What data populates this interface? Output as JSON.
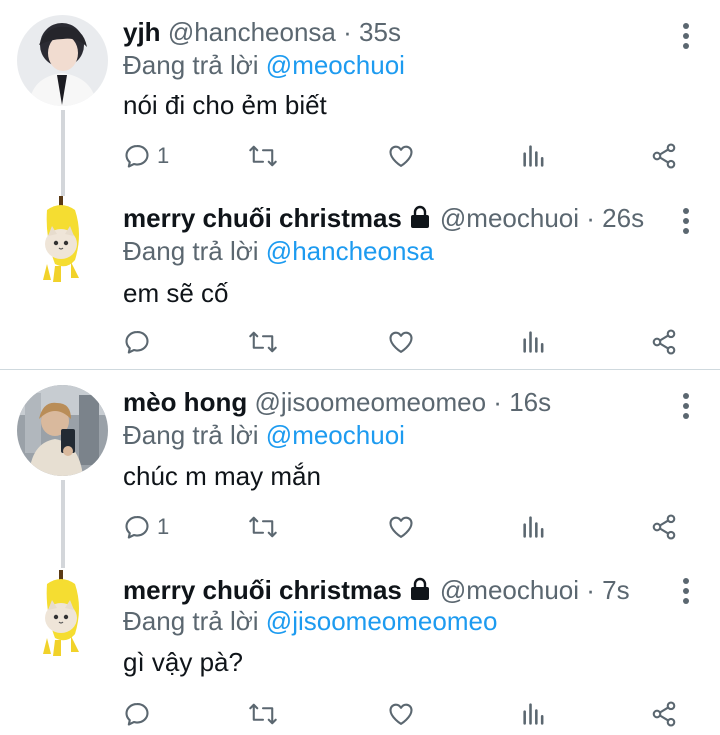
{
  "replying_prefix": "Đang trả lời",
  "conversations": [
    {
      "parent": {
        "name": "yjh",
        "handle": "@hancheonsa",
        "separator": "·",
        "time": "35s",
        "replying_to": "@meochuoi",
        "text": "nói đi cho ẻm biết",
        "reply_count": "1"
      },
      "reply": {
        "name": "merry chuối christmas",
        "handle": "@meochuoi",
        "separator": "·",
        "time": "26s",
        "replying_to": "@hancheonsa",
        "text": "em sẽ cố",
        "reply_count": ""
      }
    },
    {
      "parent": {
        "name": "mèo hong",
        "handle": "@jisoomeomeomeo",
        "separator": "·",
        "time": "16s",
        "replying_to": "@meochuoi",
        "text": "chúc m may mắn",
        "reply_count": "1"
      },
      "reply": {
        "name": "merry chuối christmas",
        "handle": "@meochuoi",
        "separator": "·",
        "time": "7s",
        "replying_to": "@jisoomeomeomeo",
        "text": "gì vậy pà?",
        "reply_count": ""
      }
    }
  ],
  "icons": {
    "reply": "reply-icon",
    "retweet": "retweet-icon",
    "like": "heart-icon",
    "views": "analytics-icon",
    "share": "share-icon",
    "more": "more-icon",
    "lock": "lock-icon"
  },
  "colors": {
    "mention": "#1d9bf0",
    "secondary_text": "#5b6770",
    "thread_line": "#d3d6da"
  }
}
